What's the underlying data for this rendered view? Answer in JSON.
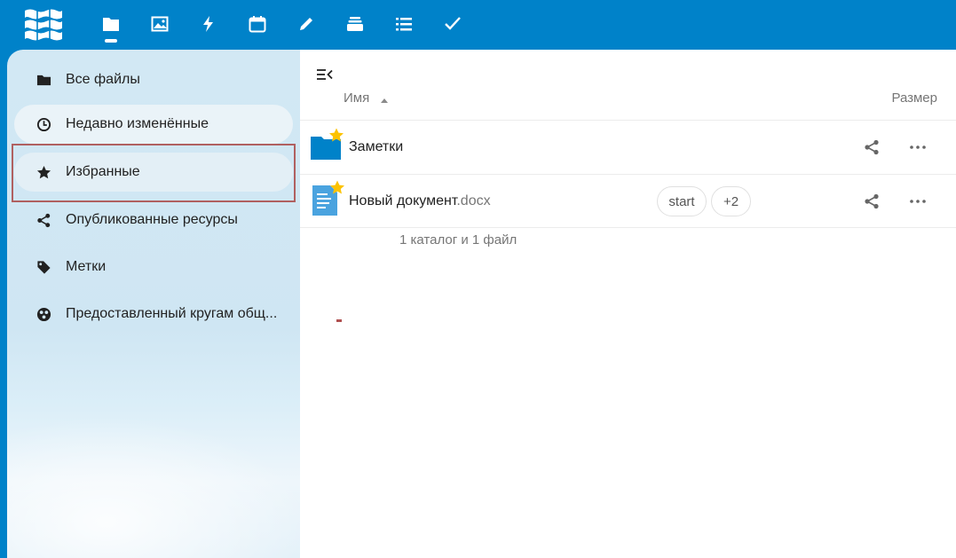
{
  "app": {
    "accent_color": "#0082c9",
    "header_icons": [
      "files-icon",
      "photos-icon",
      "activity-icon",
      "calendar-icon",
      "notes-icon",
      "deck-icon",
      "tasks-list-icon",
      "checkmark-icon"
    ]
  },
  "sidebar": {
    "items": [
      {
        "label": "Все файлы",
        "icon": "folder-icon"
      },
      {
        "label": "Недавно изменённые",
        "icon": "clock-icon"
      },
      {
        "label": "Избранные",
        "icon": "star-icon"
      },
      {
        "label": "Опубликованные ресурсы",
        "icon": "share-icon"
      },
      {
        "label": "Метки",
        "icon": "tag-icon"
      },
      {
        "label": "Предоставленный кругам общ...",
        "icon": "circles-icon"
      }
    ]
  },
  "files": {
    "columns": {
      "name": "Имя",
      "size": "Размер"
    },
    "rows": [
      {
        "name": "Заметки",
        "ext": "",
        "type": "folder",
        "favorite": true,
        "tags": []
      },
      {
        "name": "Новый документ",
        "ext": ".docx",
        "type": "document",
        "favorite": true,
        "tags": [
          "start",
          "+2"
        ]
      }
    ],
    "summary": "1 каталог и 1 файл"
  }
}
